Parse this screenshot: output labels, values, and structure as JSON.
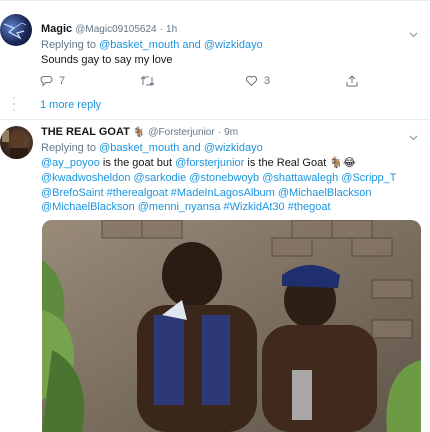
{
  "tweet1": {
    "display_name": "Magic",
    "handle": "@Magic09105624",
    "separator": "·",
    "time": "1h",
    "replying_to_label": "Replying to",
    "replying_to": "@basket_mouth and @wizkidayo",
    "text": "Sounds gay to say my love",
    "reply_count": "7",
    "retweet_count": "",
    "like_count": "3"
  },
  "more_reply_label": "1 more reply",
  "tweet2": {
    "display_name": "THE REAL GOAT",
    "display_name_emoji": "🐐",
    "handle": "@Forsterjunior",
    "separator": "·",
    "time": "9m",
    "replying_to_label": "Replying to",
    "replying_to": "@basket_mouth and @wizkidayo",
    "text_mention_1": "@ay_poyoo",
    "text_plain_1": " is the goat but ",
    "text_mention_2": "@forsterjunior",
    "text_plain_2": " is the Real Goat 🐐😂",
    "text_line_2": "@kwadwosheldon @sarkodie @stonebwoyb @shattawalegh @Scripp_T",
    "text_line_3": "@BrefoSaint #therealgoat #MadeInLagosAlbum @MichaelBlackson",
    "text_line_4": "@MichaelBlackson @menni_nyansa #WizkidAt30 #thegoat"
  },
  "icons": [
    "caret-down-icon",
    "reply-icon",
    "retweet-icon",
    "like-icon",
    "share-icon",
    "goat-emoji",
    "laughing-emoji"
  ],
  "colors": {
    "link": "#1b95e0",
    "muted": "#657786",
    "divider": "#e6ecf0"
  }
}
